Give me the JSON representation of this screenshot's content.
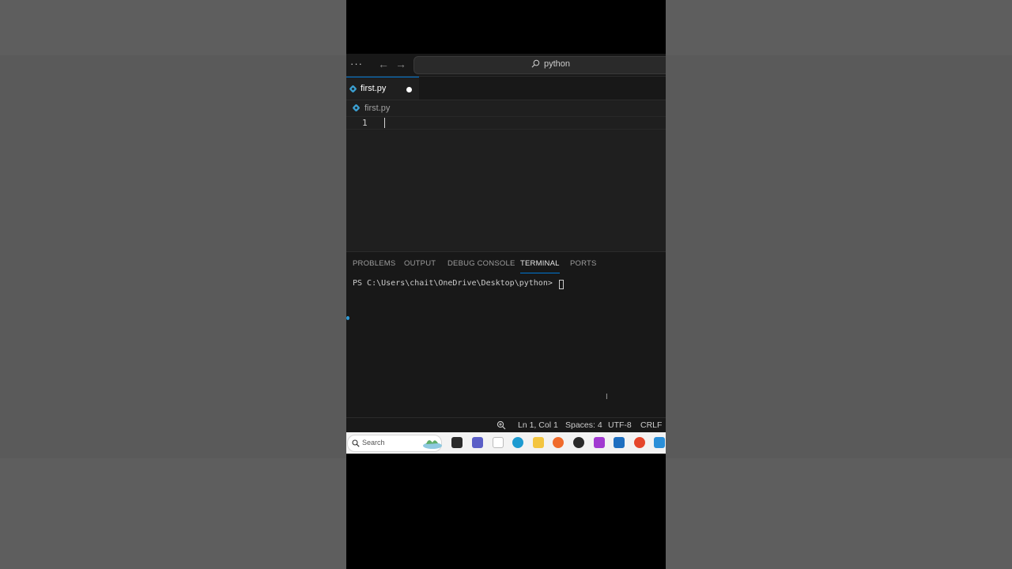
{
  "editor": {
    "search": {
      "text": "python"
    },
    "tab": {
      "label": "first.py"
    },
    "breadcrumb": {
      "label": "first.py"
    },
    "line_number": "1"
  },
  "panel": {
    "tabs": [
      {
        "label": "PROBLEMS"
      },
      {
        "label": "OUTPUT"
      },
      {
        "label": "DEBUG CONSOLE"
      },
      {
        "label": "TERMINAL",
        "active": true
      },
      {
        "label": "PORTS"
      }
    ],
    "terminal_prompt": "PS C:\\Users\\chait\\OneDrive\\Desktop\\python>"
  },
  "statusbar": {
    "position": "Ln 1, Col 1",
    "spaces": "Spaces: 4",
    "encoding": "UTF-8",
    "eol": "CRLF"
  },
  "taskbar": {
    "search_placeholder": "Search",
    "apps": [
      "widgets",
      "terminal",
      "teams",
      "notepad",
      "edge",
      "file-explorer",
      "firefox",
      "github-desktop",
      "media-player",
      "microsoft-store",
      "brave",
      "vscode"
    ]
  },
  "colors": {
    "accent": "#0078d4",
    "editor_bg": "#1f1f1f",
    "chrome_bg": "#181818",
    "python_icon": "#3b9fd1"
  }
}
